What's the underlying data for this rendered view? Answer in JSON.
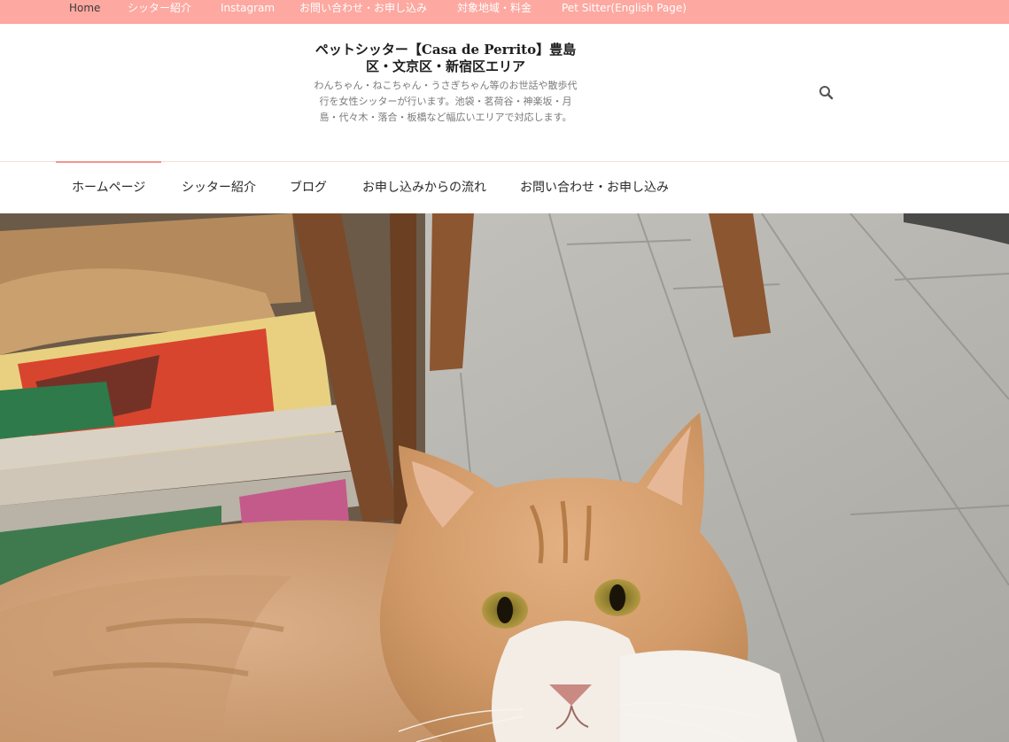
{
  "topbar": {
    "items": [
      "Home",
      "シッター紹介",
      "Instagram",
      "お問い合わせ・お申し込み",
      "対象地域・料金",
      "Pet Sitter(English Page)"
    ],
    "color": "#fda8a0"
  },
  "header": {
    "title_prefix": "ペットシッター【",
    "title_brand": "Casa de Perrito",
    "title_suffix": "】豊島区・文京区・新宿区エリア",
    "description": "わんちゃん・ねこちゃん・うさぎちゃん等のお世話や散歩代行を女性シッターが行います。池袋・茗荷谷・神楽坂・月島・代々木・落合・板橋など幅広いエリアで対応します。",
    "search_icon": "search-icon"
  },
  "mainnav": {
    "items": [
      "ホームページ",
      "シッター紹介",
      "ブログ",
      "お申し込みからの流れ",
      "お問い合わせ・お申し込み"
    ],
    "active_color": "#f2958b"
  }
}
